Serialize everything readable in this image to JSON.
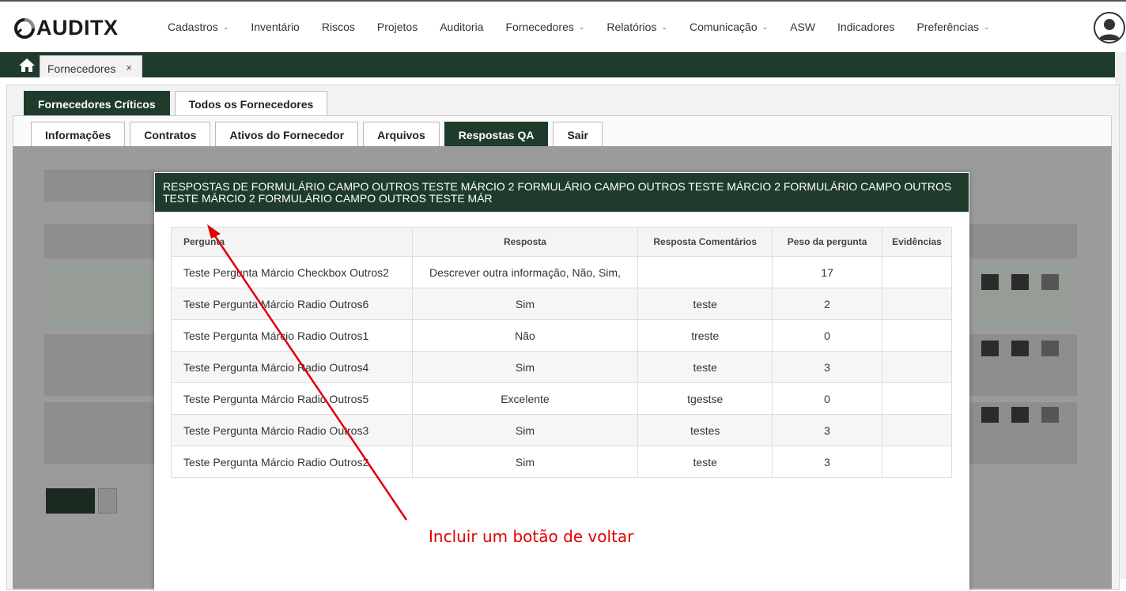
{
  "brand": {
    "logo_text": "AUDITX"
  },
  "menu": [
    {
      "label": "Cadastros",
      "caret": true
    },
    {
      "label": "Inventário",
      "caret": false
    },
    {
      "label": "Riscos",
      "caret": false
    },
    {
      "label": "Projetos",
      "caret": false
    },
    {
      "label": "Auditoria",
      "caret": false
    },
    {
      "label": "Fornecedores",
      "caret": true
    },
    {
      "label": "Relatórios",
      "caret": true
    },
    {
      "label": "Comunicação",
      "caret": true
    },
    {
      "label": "ASW",
      "caret": false
    },
    {
      "label": "Indicadores",
      "caret": false
    },
    {
      "label": "Preferências",
      "caret": true
    }
  ],
  "open_tab": {
    "label": "Fornecedores",
    "close": "×"
  },
  "main_tabs": [
    {
      "label": "Fornecedores Críticos",
      "active": true
    },
    {
      "label": "Todos os Fornecedores",
      "active": false
    }
  ],
  "sub_tabs": [
    {
      "label": "Informações",
      "active": false
    },
    {
      "label": "Contratos",
      "active": false
    },
    {
      "label": "Ativos do Fornecedor",
      "active": false
    },
    {
      "label": "Arquivos",
      "active": false
    },
    {
      "label": "Respostas QA",
      "active": true
    },
    {
      "label": "Sair",
      "active": false
    }
  ],
  "modal": {
    "title": "RESPOSTAS DE FORMULÁRIO CAMPO OUTROS TESTE MÁRCIO 2 FORMULÁRIO CAMPO OUTROS TESTE MÁRCIO 2 FORMULÁRIO CAMPO OUTROS TESTE MÁRCIO 2 FORMULÁRIO CAMPO OUTROS TESTE MÁR",
    "columns": [
      "Pergunta",
      "Resposta",
      "Resposta Comentários",
      "Peso da pergunta",
      "Evidências"
    ],
    "rows": [
      [
        "Teste Pergunta Márcio Checkbox Outros2",
        "Descrever outra informação, Não, Sim,",
        "",
        "17",
        ""
      ],
      [
        "Teste Pergunta Márcio Radio Outros6",
        "Sim",
        "teste",
        "2",
        ""
      ],
      [
        "Teste Pergunta Márcio Radio Outros1",
        "Não",
        "treste",
        "0",
        ""
      ],
      [
        "Teste Pergunta Márcio Radio Outros4",
        "Sim",
        "teste",
        "3",
        ""
      ],
      [
        "Teste Pergunta Márcio Radio Outros5",
        "Excelente",
        "tgestse",
        "0",
        ""
      ],
      [
        "Teste Pergunta Márcio Radio Outros3",
        "Sim",
        "testes",
        "3",
        ""
      ],
      [
        "Teste Pergunta Márcio Radio Outros2",
        "Sim",
        "teste",
        "3",
        ""
      ]
    ]
  },
  "annotation": {
    "text": "Incluir um botão de voltar",
    "color": "#e00000"
  },
  "colors": {
    "brand_dark_green": "#1f3b2c"
  }
}
